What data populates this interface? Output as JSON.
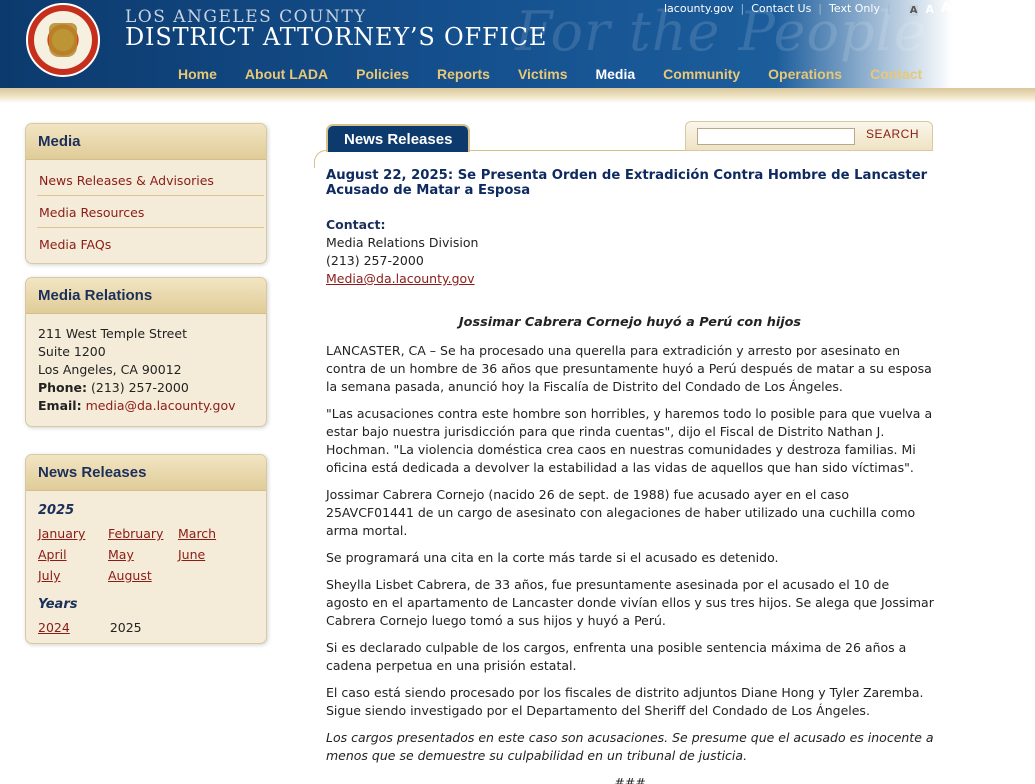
{
  "header": {
    "brand_top": "Los Angeles County",
    "brand_main": "District Attorney’s Office",
    "watermark": "For the People",
    "util_links": [
      "lacounty.gov",
      "Contact Us",
      "Text Only"
    ],
    "font_sizes": [
      "A",
      "A",
      "A"
    ],
    "nav": [
      "Home",
      "About LADA",
      "Policies",
      "Reports",
      "Victims",
      "Media",
      "Community",
      "Operations",
      "Contact"
    ],
    "active_nav": "Media"
  },
  "sidebar": {
    "media": {
      "title": "Media",
      "items": [
        "News Releases & Advisories",
        "Media Resources",
        "Media FAQs"
      ]
    },
    "media_relations": {
      "title": "Media Relations",
      "line1": "211 West Temple Street",
      "line2": "Suite 1200",
      "line3": "Los Angeles, CA 90012",
      "phone_label": "Phone:",
      "phone": "(213) 257-2000",
      "email_label": "Email:",
      "email": "media@da.lacounty.gov"
    },
    "news_releases": {
      "title": "News Releases",
      "year": "2025",
      "months": [
        "January",
        "February",
        "March",
        "April",
        "May",
        "June",
        "July",
        "August"
      ],
      "years_title": "Years",
      "years": [
        "2024",
        "2025"
      ]
    }
  },
  "main": {
    "tab": "News Releases",
    "search": {
      "placeholder": "",
      "button": "SEARCH"
    },
    "title": "August 22, 2025: Se Presenta Orden de Extradición Contra Hombre de Lancaster Acusado de Matar a Esposa",
    "contact_label": "Contact:",
    "contact_org": "Media Relations Division",
    "contact_phone": "(213) 257-2000",
    "contact_email": "Media@da.lacounty.gov",
    "subtitle": "Jossimar Cabrera Cornejo huyó a Perú con hijos",
    "paragraphs": [
      "LANCASTER, CA – Se ha procesado una querella para extradición y arresto por asesinato en contra de un hombre de 36 años que presuntamente huyó a Perú después de matar a su esposa la semana pasada, anunció hoy la Fiscalía de Distrito del Condado de Los Ángeles.",
      "\"Las acusaciones contra este hombre son horribles, y haremos todo lo posible para que vuelva a estar bajo nuestra jurisdicción para que rinda cuentas\", dijo el Fiscal de Distrito Nathan J. Hochman. \"La violencia doméstica crea caos en nuestras comunidades y destroza familias. Mi oficina está dedicada a devolver la estabilidad a las vidas de aquellos que han sido víctimas\".",
      "Jossimar Cabrera Cornejo (nacido 26 de sept. de 1988) fue acusado ayer en el caso 25AVCF01441 de un cargo de asesinato con alegaciones de haber utilizado una cuchilla como arma mortal.",
      "Se programará una cita en la corte más tarde si el acusado es detenido.",
      "Sheylla Lisbet Cabrera, de 33 años, fue presuntamente asesinada por el acusado el 10 de agosto en el apartamento de Lancaster donde vivían ellos y sus tres hijos. Se alega que Jossimar Cabrera Cornejo luego tomó a sus hijos y huyó a Perú.",
      "Si es declarado culpable de los cargos, enfrenta una posible sentencia máxima de 26 años a cadena perpetua en una prisión estatal.",
      "El caso está siendo procesado por los fiscales de distrito adjuntos Diane Hong y Tyler Zaremba. Sigue siendo investigado por el Departamento del Sheriff del Condado de Los Ángeles."
    ],
    "disclaimer": "Los cargos presentados en este caso son acusaciones. Se presume que el acusado es inocente a menos que se demuestre su culpabilidad en un tribunal de justicia.",
    "endmark": "###"
  }
}
